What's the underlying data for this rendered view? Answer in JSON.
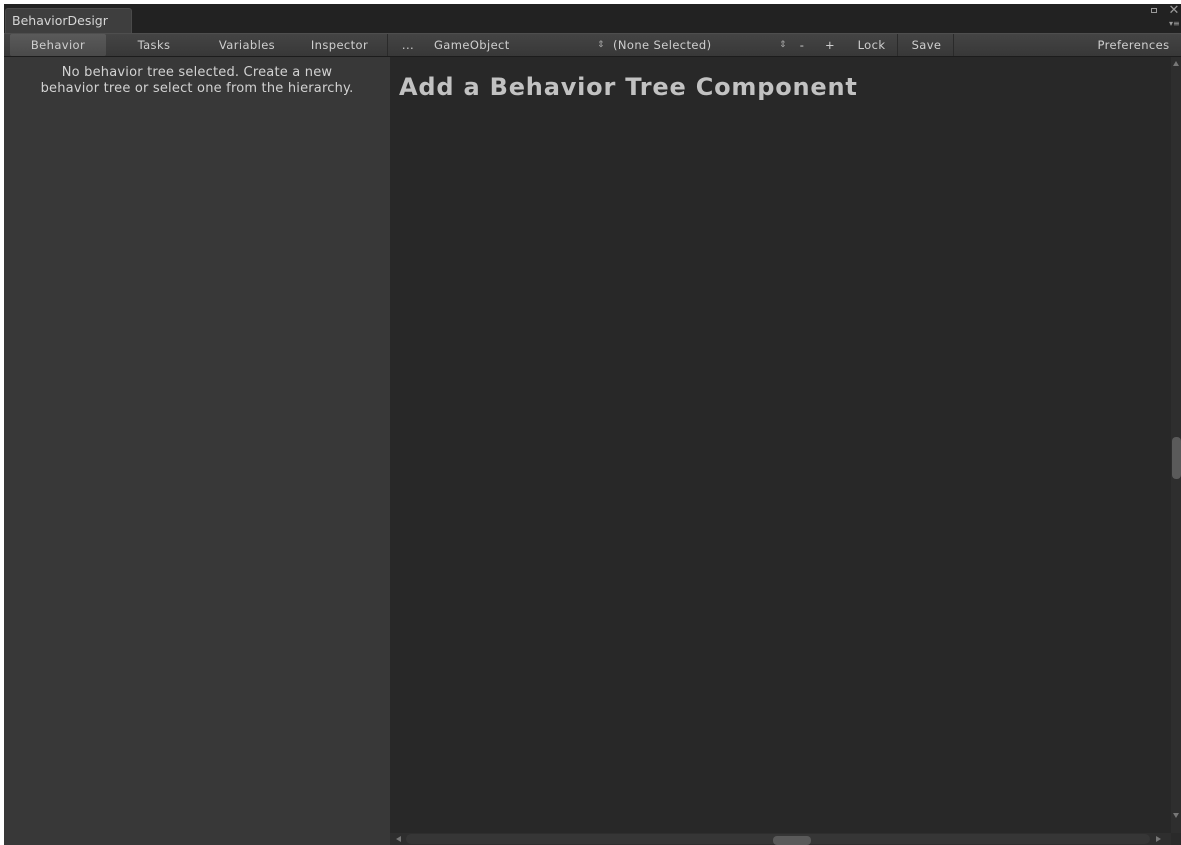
{
  "window": {
    "tab_title": "BehaviorDesigr"
  },
  "toolbar": {
    "tabs": [
      {
        "label": "Behavior",
        "active": true
      },
      {
        "label": "Tasks",
        "active": false
      },
      {
        "label": "Variables",
        "active": false
      },
      {
        "label": "Inspector",
        "active": false
      }
    ],
    "more_label": "...",
    "gameobject_label": "GameObject",
    "selection_label": "(None Selected)",
    "remove_label": "-",
    "add_label": "+",
    "lock_label": "Lock",
    "save_label": "Save",
    "preferences_label": "Preferences"
  },
  "left_panel": {
    "message_line1": "No behavior tree selected. Create a new",
    "message_line2": "behavior tree or select one from the hierarchy."
  },
  "graph": {
    "title": "Add a Behavior Tree Component"
  },
  "icons": {
    "maximize": "maximize-icon",
    "close": "close-icon",
    "tab_menu": "tab-menu-icon",
    "dropdown_arrow": "dropdown-arrow-icon"
  },
  "colors": {
    "window_bg": "#1f1f1f",
    "toolbar_bg": "#3c3c3c",
    "active_tab_bg": "#535353",
    "left_panel_bg": "#383838",
    "graph_bg": "#282828",
    "title_text": "#c2c2c2"
  }
}
